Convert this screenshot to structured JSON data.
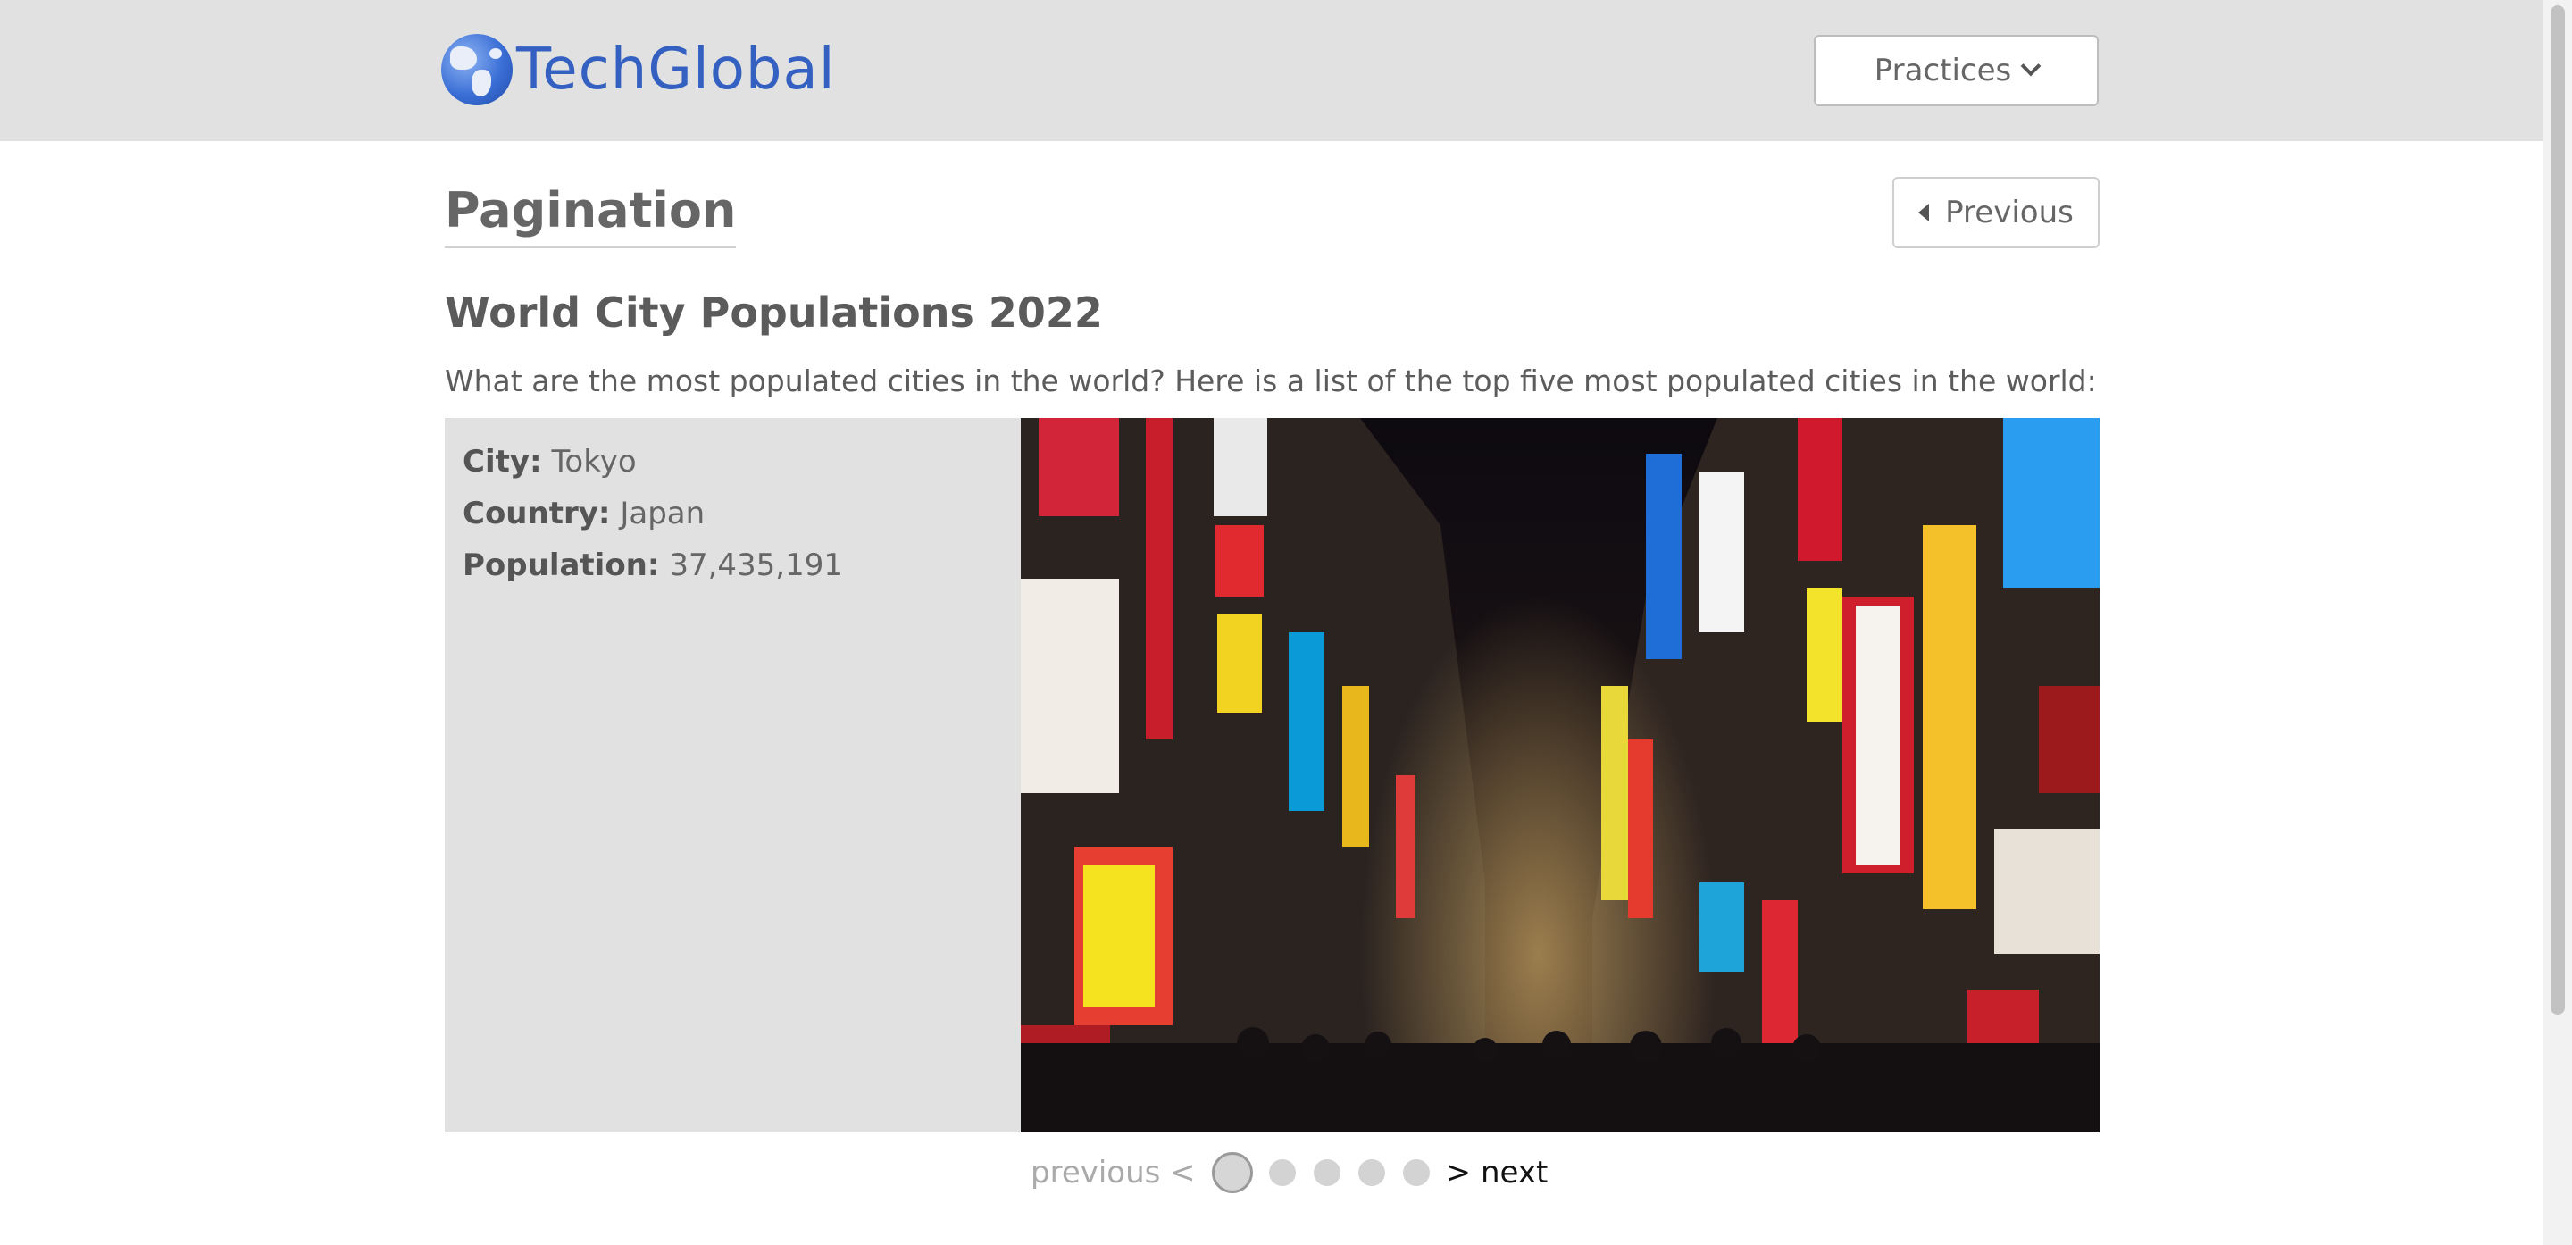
{
  "header": {
    "logo_text": "TechGlobal",
    "practices_label": "Practices"
  },
  "page": {
    "title": "Pagination",
    "previous_button": "Previous",
    "subtitle": "World City Populations 2022",
    "description": "What are the most populated cities in the world? Here is a list of the top five most populated cities in the world:"
  },
  "city": {
    "city_label": "City:",
    "city_value": "Tokyo",
    "country_label": "Country:",
    "country_value": "Japan",
    "population_label": "Population:",
    "population_value": "37,435,191"
  },
  "pager": {
    "previous_label": "previous <",
    "next_label": "> next",
    "total_pages": 5,
    "current_page": 1
  },
  "colors": {
    "brand": "#3461c1",
    "header_bg": "#e1e1e1",
    "card_bg": "#e1e1e1"
  }
}
